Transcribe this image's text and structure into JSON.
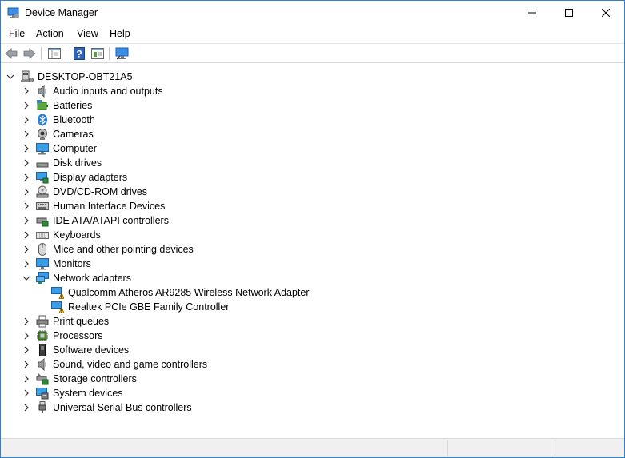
{
  "window": {
    "title": "Device Manager",
    "minimize_glyph": "—",
    "maximize_glyph": "☐",
    "close_glyph": "✕"
  },
  "menu": [
    "File",
    "Action",
    "View",
    "Help"
  ],
  "toolbar": {
    "buttons": [
      "back-icon",
      "forward-icon",
      "show-hide-console-tree-icon",
      "help-icon",
      "properties-icon",
      "scan-hardware-icon"
    ]
  },
  "tree": {
    "root": "DESKTOP-OBT21A5",
    "categories": [
      {
        "label": "Audio inputs and outputs",
        "icon": "speaker-icon",
        "expanded": false
      },
      {
        "label": "Batteries",
        "icon": "battery-icon",
        "expanded": false
      },
      {
        "label": "Bluetooth",
        "icon": "bluetooth-icon",
        "expanded": false
      },
      {
        "label": "Cameras",
        "icon": "camera-icon",
        "expanded": false
      },
      {
        "label": "Computer",
        "icon": "computer-icon",
        "expanded": false
      },
      {
        "label": "Disk drives",
        "icon": "disk-drive-icon",
        "expanded": false
      },
      {
        "label": "Display adapters",
        "icon": "display-adapter-icon",
        "expanded": false
      },
      {
        "label": "DVD/CD-ROM drives",
        "icon": "dvd-drive-icon",
        "expanded": false
      },
      {
        "label": "Human Interface Devices",
        "icon": "hid-icon",
        "expanded": false
      },
      {
        "label": "IDE ATA/ATAPI controllers",
        "icon": "ide-controller-icon",
        "expanded": false
      },
      {
        "label": "Keyboards",
        "icon": "keyboard-icon",
        "expanded": false
      },
      {
        "label": "Mice and other pointing devices",
        "icon": "mouse-icon",
        "expanded": false
      },
      {
        "label": "Monitors",
        "icon": "monitor-icon",
        "expanded": false
      },
      {
        "label": "Network adapters",
        "icon": "network-adapter-icon",
        "expanded": true,
        "children": [
          {
            "label": "Qualcomm Atheros AR9285 Wireless Network Adapter",
            "icon": "network-adapter-warning-icon"
          },
          {
            "label": "Realtek PCIe GBE Family Controller",
            "icon": "network-adapter-warning-icon"
          }
        ]
      },
      {
        "label": "Print queues",
        "icon": "printer-icon",
        "expanded": false
      },
      {
        "label": "Processors",
        "icon": "processor-icon",
        "expanded": false
      },
      {
        "label": "Software devices",
        "icon": "software-device-icon",
        "expanded": false
      },
      {
        "label": "Sound, video and game controllers",
        "icon": "sound-controller-icon",
        "expanded": false
      },
      {
        "label": "Storage controllers",
        "icon": "storage-controller-icon",
        "expanded": false
      },
      {
        "label": "System devices",
        "icon": "system-devices-icon",
        "expanded": false
      },
      {
        "label": "Universal Serial Bus controllers",
        "icon": "usb-icon",
        "expanded": false
      }
    ]
  },
  "colors": {
    "window_border": "#2f7fc9",
    "icon_blue": "#2b7fd4",
    "warning_yellow": "#f5c518"
  }
}
